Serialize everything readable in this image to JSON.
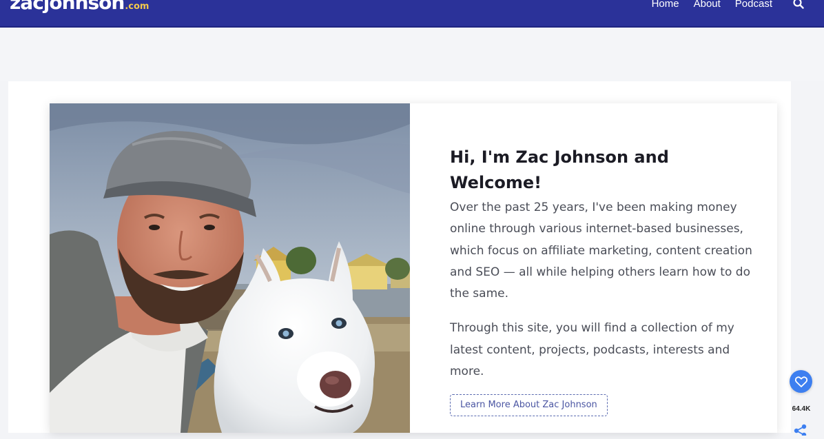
{
  "header": {
    "logo": {
      "part1": "zac",
      "part2": "johnson",
      "tld": ".com"
    },
    "nav": [
      "Home",
      "About",
      "Podcast"
    ],
    "search_icon": "search-icon",
    "bg_color": "#2b3299"
  },
  "hero": {
    "title": "Hi, I'm Zac Johnson and Welcome!",
    "paragraphs": [
      "Over the past 25 years, I've been making money online through various internet-based businesses, which focus on affiliate marketing, content creation and SEO — all while helping others learn how to do the same.",
      "Through this site, you will find a collection of my latest content, projects, podcasts, interests and more."
    ],
    "cta_label": "Learn More About Zac Johnson"
  },
  "share": {
    "like_icon": "heart-icon",
    "count": "64.4K",
    "share_icon": "share-icon",
    "accent": "#3d7ff0"
  }
}
